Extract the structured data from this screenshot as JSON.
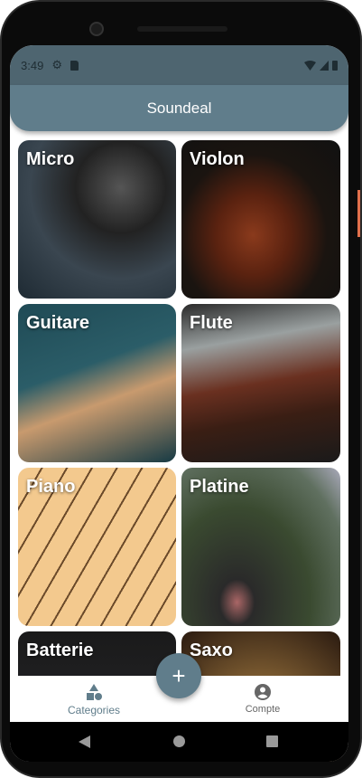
{
  "status": {
    "time": "3:49"
  },
  "appbar": {
    "title": "Soundeal"
  },
  "categories": [
    {
      "label": "Micro"
    },
    {
      "label": "Violon"
    },
    {
      "label": "Guitare"
    },
    {
      "label": "Flute"
    },
    {
      "label": "Piano"
    },
    {
      "label": "Platine"
    },
    {
      "label": "Batterie"
    },
    {
      "label": "Saxo"
    }
  ],
  "bottom_nav": {
    "categories": "Categories",
    "account": "Compte",
    "fab": "+"
  },
  "colors": {
    "primary": "#607d8b"
  }
}
